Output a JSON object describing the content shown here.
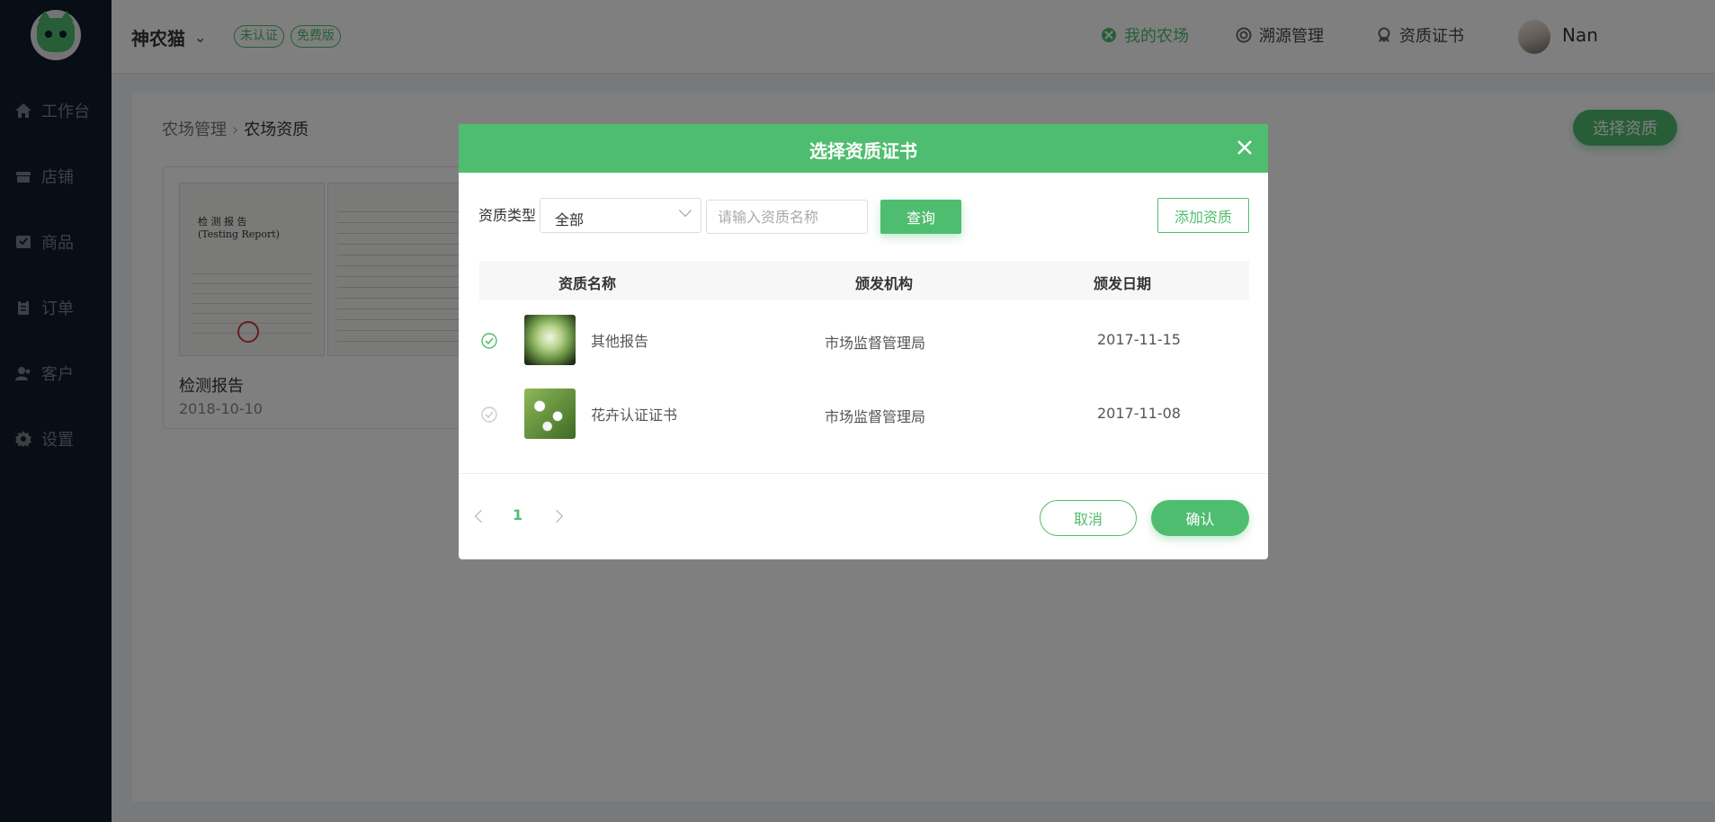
{
  "colors": {
    "accent": "#4fbd6f",
    "sidebar": "#0f1c2b",
    "overlay": "rgba(0,0,0,0.5)"
  },
  "sidebar": {
    "items": [
      {
        "label": "工作台",
        "icon": "home-icon"
      },
      {
        "label": "店铺",
        "icon": "store-icon"
      },
      {
        "label": "商品",
        "icon": "product-icon"
      },
      {
        "label": "订单",
        "icon": "order-icon"
      },
      {
        "label": "客户",
        "icon": "customer-icon"
      },
      {
        "label": "设置",
        "icon": "gear-icon"
      }
    ]
  },
  "header": {
    "brand": "神农猫",
    "badges": [
      "未认证",
      "免费版"
    ],
    "nav": [
      {
        "label": "我的农场",
        "icon": "farm-icon",
        "active": true
      },
      {
        "label": "溯源管理",
        "icon": "trace-icon"
      },
      {
        "label": "资质证书",
        "icon": "certificate-icon"
      }
    ],
    "user_name": "Nan"
  },
  "page": {
    "breadcrumb": [
      "农场管理",
      "农场资质"
    ],
    "select_btn": "选择资质",
    "card": {
      "title": "检测报告",
      "date": "2018-10-10",
      "doc_heading": "检 测 报 告",
      "doc_sub": "(Testing Report)"
    }
  },
  "modal": {
    "title": "选择资质证书",
    "filter_label": "资质类型",
    "select_value": "全部",
    "search_placeholder": "请输入资质名称",
    "query_btn": "查询",
    "add_btn": "添加资质",
    "columns": [
      "资质名称",
      "颁发机构",
      "颁发日期"
    ],
    "rows": [
      {
        "name": "其他报告",
        "org": "市场监督管理局",
        "date": "2017-11-15",
        "selected": true
      },
      {
        "name": "花卉认证证书",
        "org": "市场监督管理局",
        "date": "2017-11-08",
        "selected": false
      }
    ],
    "page": "1",
    "cancel_btn": "取消",
    "ok_btn": "确认"
  }
}
